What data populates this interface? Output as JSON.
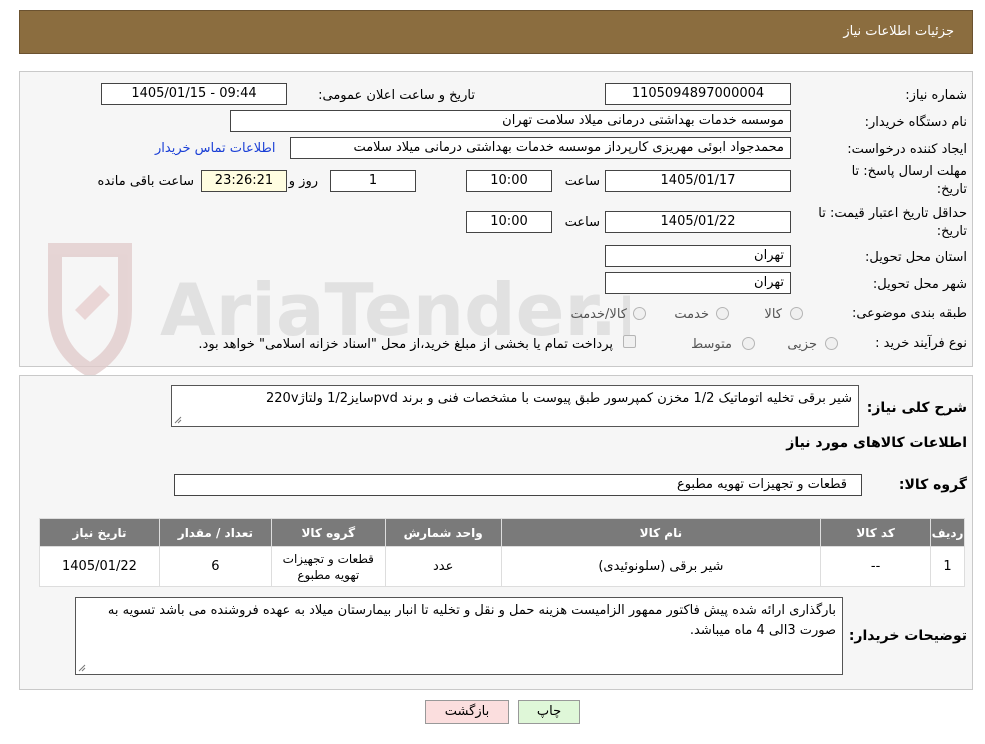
{
  "header": {
    "title": "جزئیات اطلاعات نیاز"
  },
  "form": {
    "need_number": {
      "label": "شماره نیاز:",
      "value": "1105094897000004"
    },
    "announce_datetime": {
      "label": "تاریخ و ساعت اعلان عمومی:",
      "value": "1405/01/15 - 09:44"
    },
    "buyer_org": {
      "label": "نام دستگاه خریدار:",
      "value": "موسسه خدمات بهداشتی درمانی میلاد سلامت تهران"
    },
    "requester": {
      "label": "ایجاد کننده درخواست:",
      "value": "محمدجواد ابوئی مهریزی کارپرداز موسسه خدمات بهداشتی درمانی میلاد سلامت",
      "contact_link": "اطلاعات تماس خریدار"
    },
    "reply_deadline": {
      "label_line1": "مهلت ارسال پاسخ: تا",
      "label_line2": "تاریخ:",
      "date": "1405/01/17",
      "time_label": "ساعت",
      "time": "10:00",
      "days": "1",
      "days_label": "روز و",
      "remaining": "23:26:21",
      "remaining_label": "ساعت باقی مانده"
    },
    "price_validity": {
      "label_line1": "حداقل تاریخ اعتبار قیمت: تا",
      "label_line2": "تاریخ:",
      "date": "1405/01/22",
      "time_label": "ساعت",
      "time": "10:00"
    },
    "delivery_province": {
      "label": "استان محل تحویل:",
      "value": "تهران"
    },
    "delivery_city": {
      "label": "شهر محل تحویل:",
      "value": "تهران"
    },
    "category": {
      "label": "طبقه بندی موضوعی:",
      "options": [
        "کالا",
        "خدمت",
        "کالا/خدمت"
      ]
    },
    "process_type": {
      "label": "نوع فرآیند خرید :",
      "options": [
        "جزیی",
        "متوسط"
      ],
      "payment_note": "پرداخت تمام یا بخشی از مبلغ خرید،از محل \"اسناد خزانه اسلامی\" خواهد بود."
    }
  },
  "description": {
    "label": "شرح کلی نیاز:",
    "value": "شیر برقی تخلیه اتوماتیک 1/2 مخزن کمپرسور طبق پیوست با مشخصات فنی و برند pvdسایز1/2 ولتاژ220v"
  },
  "goods_info": {
    "heading": "اطلاعات کالاهای مورد نیاز",
    "group_label": "گروه کالا:",
    "group_value": "قطعات و تجهیزات تهویه مطبوع"
  },
  "table": {
    "headers": [
      "ردیف",
      "کد کالا",
      "نام کالا",
      "واحد شمارش",
      "گروه کالا",
      "تعداد / مقدار",
      "تاریخ نیاز"
    ],
    "rows": [
      [
        "1",
        "--",
        "شیر برقی (سلونوئیدی)",
        "عدد",
        "قطعات و تجهیزات تهویه مطبوع",
        "6",
        "1405/01/22"
      ]
    ]
  },
  "buyer_notes": {
    "label": "توضیحات خریدار:",
    "value": "بارگذاری ارائه شده پیش فاکتور ممهور الزامیست هزینه حمل و نقل و تخلیه تا انبار بیمارستان میلاد به عهده فروشنده می باشد تسویه به صورت 3الی 4 ماه میباشد."
  },
  "buttons": {
    "print": "چاپ",
    "back": "بازگشت"
  },
  "watermark": {
    "text": "AriaTender.neT"
  },
  "colors": {
    "header_bg": "#8b6d3f",
    "table_header_bg": "#7a7a7a",
    "link": "#1a3fd6",
    "back_button_bg": "#fbdede",
    "print_button_bg": "#dff7d8"
  }
}
